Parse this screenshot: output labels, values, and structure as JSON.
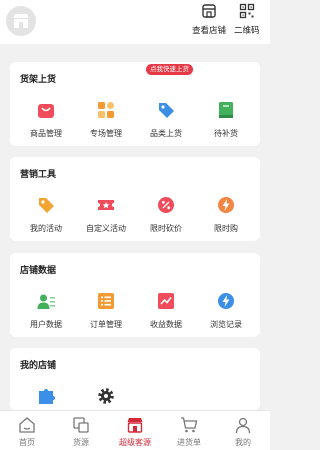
{
  "header": {
    "view_store": "查看店铺",
    "qrcode": "二维码"
  },
  "sections": [
    {
      "title": "货架上货",
      "items": [
        {
          "label": "商品管理",
          "icon": "shopping-bag-icon",
          "color": "#ef4d5c"
        },
        {
          "label": "专场管理",
          "icon": "grid-icon",
          "color": "#f39a33"
        },
        {
          "label": "品类上货",
          "icon": "tag-icon",
          "color": "#3b8fe6",
          "badge": "点我快速上货"
        },
        {
          "label": "待补货",
          "icon": "book-icon",
          "color": "#43b05c"
        }
      ]
    },
    {
      "title": "营销工具",
      "items": [
        {
          "label": "我的活动",
          "icon": "tag-icon",
          "color": "#f2a535"
        },
        {
          "label": "自定义活动",
          "icon": "ticket-icon",
          "color": "#ef4d5c"
        },
        {
          "label": "限时砍价",
          "icon": "discount-icon",
          "color": "#ef4d5c"
        },
        {
          "label": "限时购",
          "icon": "flash-icon",
          "color": "#f28542"
        }
      ]
    },
    {
      "title": "店铺数据",
      "items": [
        {
          "label": "用户数据",
          "icon": "user-card-icon",
          "color": "#43b05c"
        },
        {
          "label": "订单管理",
          "icon": "list-icon",
          "color": "#f39a33"
        },
        {
          "label": "收益数据",
          "icon": "chart-icon",
          "color": "#ef4d5c"
        },
        {
          "label": "浏览记录",
          "icon": "flash-icon",
          "color": "#3b8fe6"
        }
      ]
    },
    {
      "title": "我的店铺",
      "items": [
        {
          "label": "",
          "icon": "puzzle-icon",
          "color": "#3b8fe6"
        },
        {
          "label": "",
          "icon": "gear-icon",
          "color": "#333333"
        }
      ]
    }
  ],
  "tabs": [
    {
      "label": "首页",
      "icon": "home-icon",
      "active": false
    },
    {
      "label": "货源",
      "icon": "supply-icon",
      "active": false
    },
    {
      "label": "超级客源",
      "icon": "store-tag-icon",
      "active": true
    },
    {
      "label": "进货单",
      "icon": "cart-icon",
      "active": false
    },
    {
      "label": "我的",
      "icon": "person-icon",
      "active": false
    }
  ],
  "colors": {
    "accent": "#d22a3a",
    "background": "#f1f1f1",
    "card": "#ffffff"
  }
}
